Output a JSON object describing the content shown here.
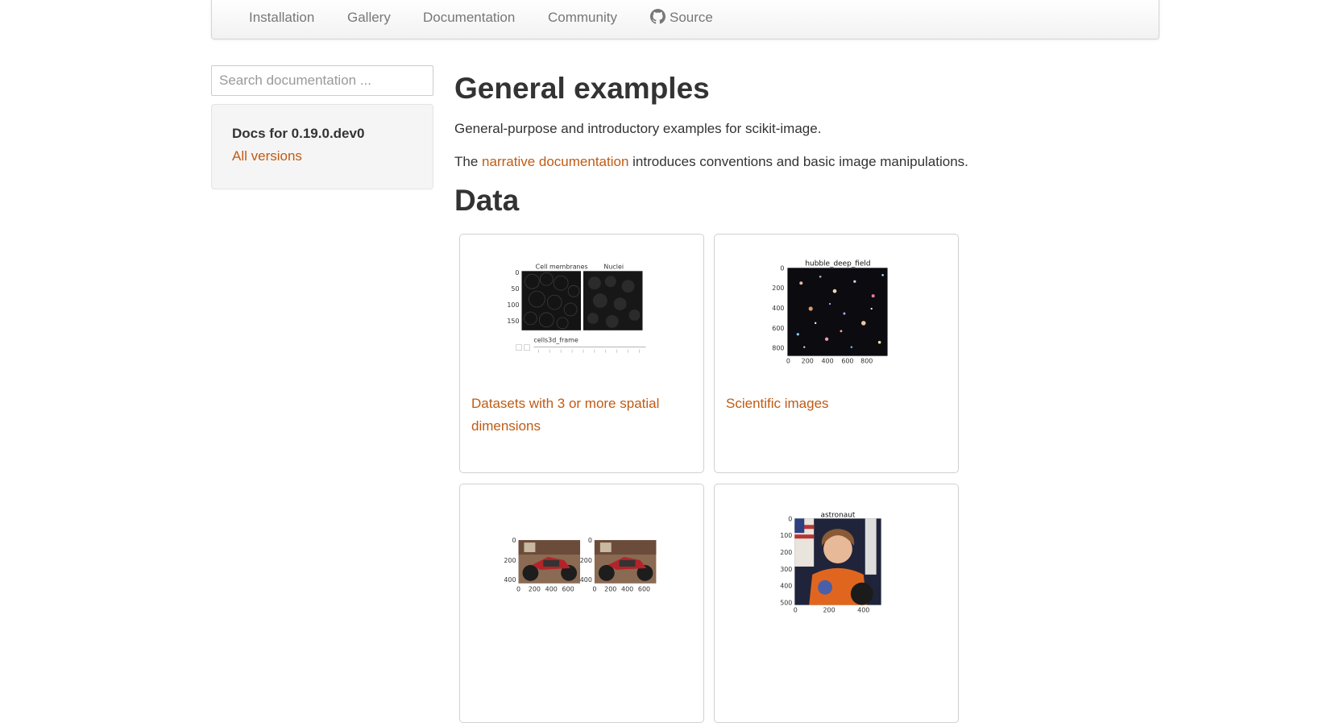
{
  "nav": {
    "items": [
      "Installation",
      "Gallery",
      "Documentation",
      "Community"
    ],
    "source_label": "Source",
    "source_icon": "github-icon"
  },
  "sidebar": {
    "search_placeholder": "Search documentation ...",
    "docs_for": "Docs for 0.19.0.dev0",
    "all_versions": "All versions"
  },
  "main": {
    "title": "General examples",
    "intro": "General-purpose and introductory examples for scikit-image.",
    "para_before_link": "The ",
    "link_text": "narrative documentation",
    "para_after_link": " introduces conventions and basic image manipulations.",
    "section_title": "Data"
  },
  "gallery": [
    {
      "label": "Datasets with 3 or more spatial dimensions",
      "thumb": "plot-3d-datasets",
      "thumb_titles": [
        "Cell membranes",
        "Nuclei"
      ],
      "slider_label": "cells3d_frame"
    },
    {
      "label": "Scientific images",
      "thumb": "hubble-deep-field",
      "thumb_title": "hubble_deep_field",
      "y_ticks": [
        "0",
        "200",
        "400",
        "600",
        "800"
      ],
      "x_ticks": [
        "0",
        "200",
        "400",
        "600",
        "800"
      ]
    },
    {
      "label": "",
      "thumb": "motorcycle-stereo-pair",
      "y_ticks": [
        "0",
        "200",
        "400"
      ],
      "x_ticks": [
        "0",
        "200",
        "400",
        "600"
      ]
    },
    {
      "label": "",
      "thumb": "astronaut",
      "thumb_title": "astronaut",
      "y_ticks": [
        "0",
        "100",
        "200",
        "300",
        "400",
        "500"
      ],
      "x_ticks": [
        "0",
        "200",
        "400"
      ]
    }
  ],
  "colors": {
    "link": "#c05b14",
    "text": "#333333",
    "nav_text": "#777777"
  }
}
